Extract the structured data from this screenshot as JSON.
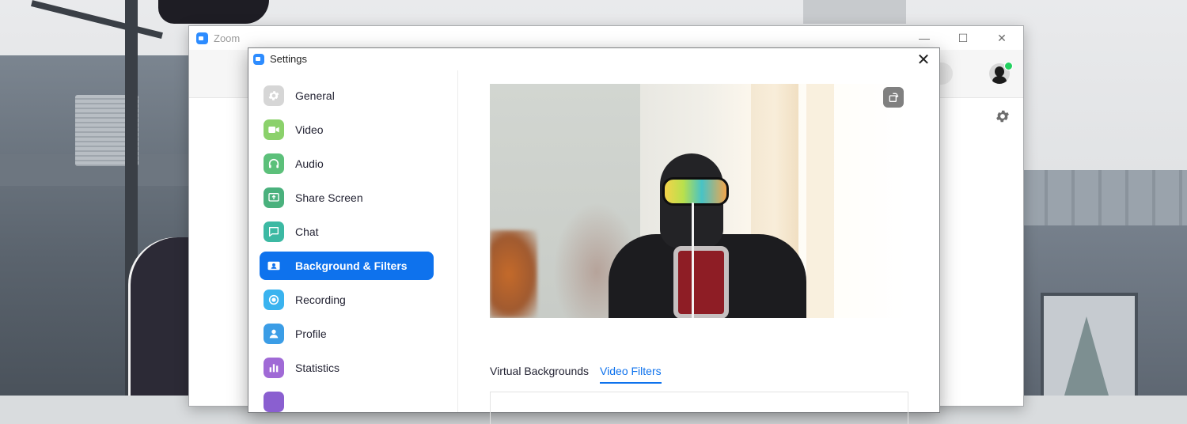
{
  "zoom_window": {
    "title": "Zoom",
    "controls": {
      "minimize": "—",
      "maximize": "☐",
      "close": "✕"
    }
  },
  "settings": {
    "title": "Settings",
    "close_glyph": "✕",
    "sidebar": {
      "items": [
        {
          "label": "General",
          "icon": "gear-icon",
          "color": "#d6d6d6"
        },
        {
          "label": "Video",
          "icon": "video-camera-icon",
          "color": "#8bd16b"
        },
        {
          "label": "Audio",
          "icon": "headphones-icon",
          "color": "#5cc07a"
        },
        {
          "label": "Share Screen",
          "icon": "share-screen-icon",
          "color": "#4ab17d"
        },
        {
          "label": "Chat",
          "icon": "chat-bubble-icon",
          "color": "#3cb9a3"
        },
        {
          "label": "Background & Filters",
          "icon": "background-person-icon",
          "color": "#0e72ed",
          "active": true
        },
        {
          "label": "Recording",
          "icon": "record-icon",
          "color": "#3ab3ef"
        },
        {
          "label": "Profile",
          "icon": "profile-icon",
          "color": "#3b9de6"
        },
        {
          "label": "Statistics",
          "icon": "bar-chart-icon",
          "color": "#a06ad6"
        }
      ]
    },
    "tabs": [
      {
        "label": "Virtual Backgrounds",
        "active": false
      },
      {
        "label": "Video Filters",
        "active": true
      }
    ]
  },
  "colors": {
    "accent": "#0e72ed",
    "zoom_brand": "#2d8cff",
    "presence_online": "#23d160"
  }
}
